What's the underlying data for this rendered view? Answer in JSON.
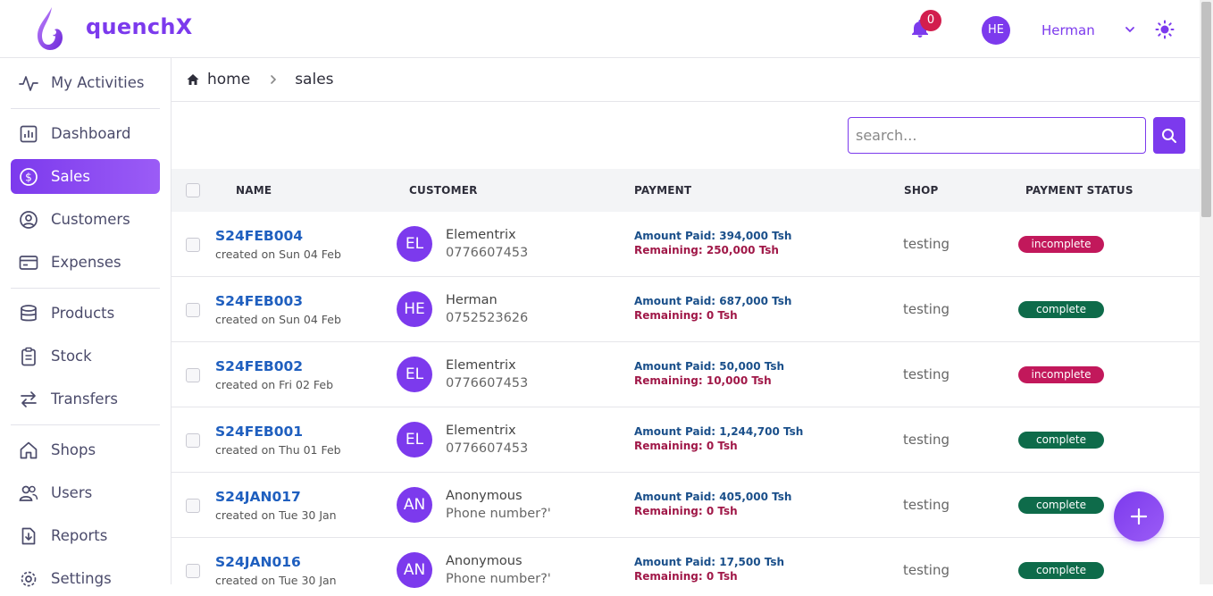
{
  "app": {
    "name": "quenchX"
  },
  "colors": {
    "accent": "#7c3aed",
    "link": "#1f5fbf",
    "badge": "#d21e4e",
    "complete": "#0e6b4a",
    "incomplete": "#c2185b"
  },
  "header": {
    "notifications": "0",
    "user_initials": "HE",
    "user_name": "Herman"
  },
  "sidebar": {
    "items": [
      {
        "label": "My Activities",
        "icon": "activity-icon"
      },
      {
        "label": "Dashboard",
        "icon": "chart-icon"
      },
      {
        "label": "Sales",
        "icon": "dollar-icon",
        "active": true
      },
      {
        "label": "Customers",
        "icon": "user-circle-icon"
      },
      {
        "label": "Expenses",
        "icon": "card-icon"
      },
      {
        "label": "Products",
        "icon": "database-icon"
      },
      {
        "label": "Stock",
        "icon": "clipboard-icon"
      },
      {
        "label": "Transfers",
        "icon": "arrows-icon"
      },
      {
        "label": "Shops",
        "icon": "house-icon"
      },
      {
        "label": "Users",
        "icon": "users-icon"
      },
      {
        "label": "Reports",
        "icon": "download-icon"
      },
      {
        "label": "Settings",
        "icon": "gear-icon"
      }
    ]
  },
  "breadcrumb": {
    "home": "home",
    "current": "sales"
  },
  "search": {
    "placeholder": "search..."
  },
  "table": {
    "columns": [
      "NAME",
      "CUSTOMER",
      "PAYMENT",
      "SHOP",
      "PAYMENT STATUS"
    ],
    "rows": [
      {
        "name": "S24FEB004",
        "created": "created on Sun 04 Feb",
        "initials": "EL",
        "customer": "Elementrix",
        "phone": "0776607453",
        "paid": "Amount Paid: 394,000 Tsh",
        "remaining": "Remaining: 250,000 Tsh",
        "shop": "testing",
        "status": "incomplete"
      },
      {
        "name": "S24FEB003",
        "created": "created on Sun 04 Feb",
        "initials": "HE",
        "customer": "Herman",
        "phone": "0752523626",
        "paid": "Amount Paid: 687,000 Tsh",
        "remaining": "Remaining: 0 Tsh",
        "shop": "testing",
        "status": "complete"
      },
      {
        "name": "S24FEB002",
        "created": "created on Fri 02 Feb",
        "initials": "EL",
        "customer": "Elementrix",
        "phone": "0776607453",
        "paid": "Amount Paid: 50,000 Tsh",
        "remaining": "Remaining: 10,000 Tsh",
        "shop": "testing",
        "status": "incomplete"
      },
      {
        "name": "S24FEB001",
        "created": "created on Thu 01 Feb",
        "initials": "EL",
        "customer": "Elementrix",
        "phone": "0776607453",
        "paid": "Amount Paid: 1,244,700 Tsh",
        "remaining": "Remaining: 0 Tsh",
        "shop": "testing",
        "status": "complete"
      },
      {
        "name": "S24JAN017",
        "created": "created on Tue 30 Jan",
        "initials": "AN",
        "customer": "Anonymous",
        "phone": "Phone number?'",
        "paid": "Amount Paid: 405,000 Tsh",
        "remaining": "Remaining: 0 Tsh",
        "shop": "testing",
        "status": "complete"
      },
      {
        "name": "S24JAN016",
        "created": "created on Tue 30 Jan",
        "initials": "AN",
        "customer": "Anonymous",
        "phone": "Phone number?'",
        "paid": "Amount Paid: 17,500 Tsh",
        "remaining": "Remaining: 0 Tsh",
        "shop": "testing",
        "status": "complete"
      }
    ]
  }
}
